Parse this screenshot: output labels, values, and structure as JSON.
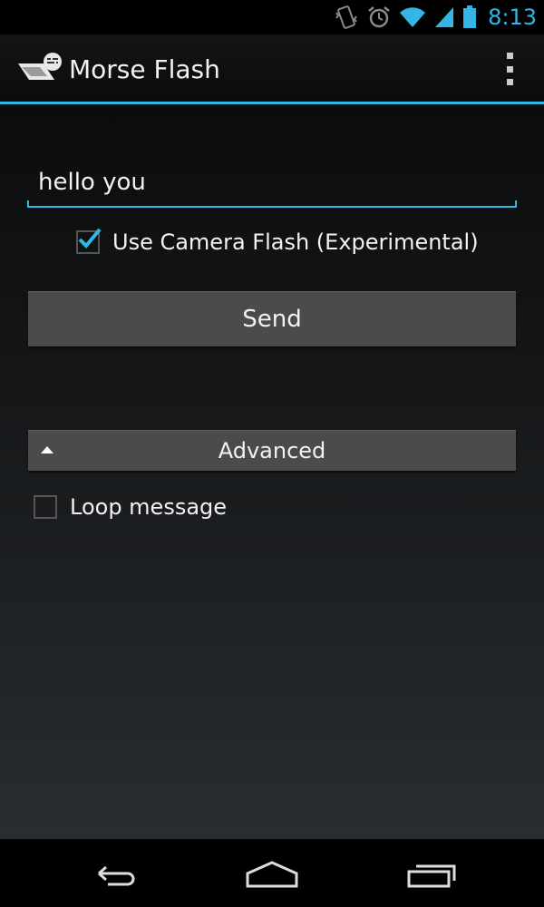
{
  "status_bar": {
    "time": "8:13",
    "icons": [
      "vibrate-icon",
      "alarm-icon",
      "wifi-icon",
      "signal-icon",
      "battery-icon"
    ],
    "accent": "#33b5e5"
  },
  "action_bar": {
    "title": "Morse Flash",
    "app_icon": "morse-flash-app-icon",
    "overflow_icon": "overflow-menu-icon"
  },
  "message_input": {
    "value": "hello you",
    "placeholder": ""
  },
  "camera_flash_checkbox": {
    "label": "Use Camera Flash (Experimental)",
    "checked": true
  },
  "send_button": {
    "label": "Send"
  },
  "advanced_section": {
    "label": "Advanced",
    "expanded": true,
    "loop_checkbox": {
      "label": "Loop message",
      "checked": false
    }
  },
  "nav_bar": {
    "buttons": [
      "back-icon",
      "home-icon",
      "recent-apps-icon"
    ]
  },
  "colors": {
    "accent": "#33b5e5",
    "button_bg": "#4a4b4d",
    "text": "#f2f2f2"
  }
}
